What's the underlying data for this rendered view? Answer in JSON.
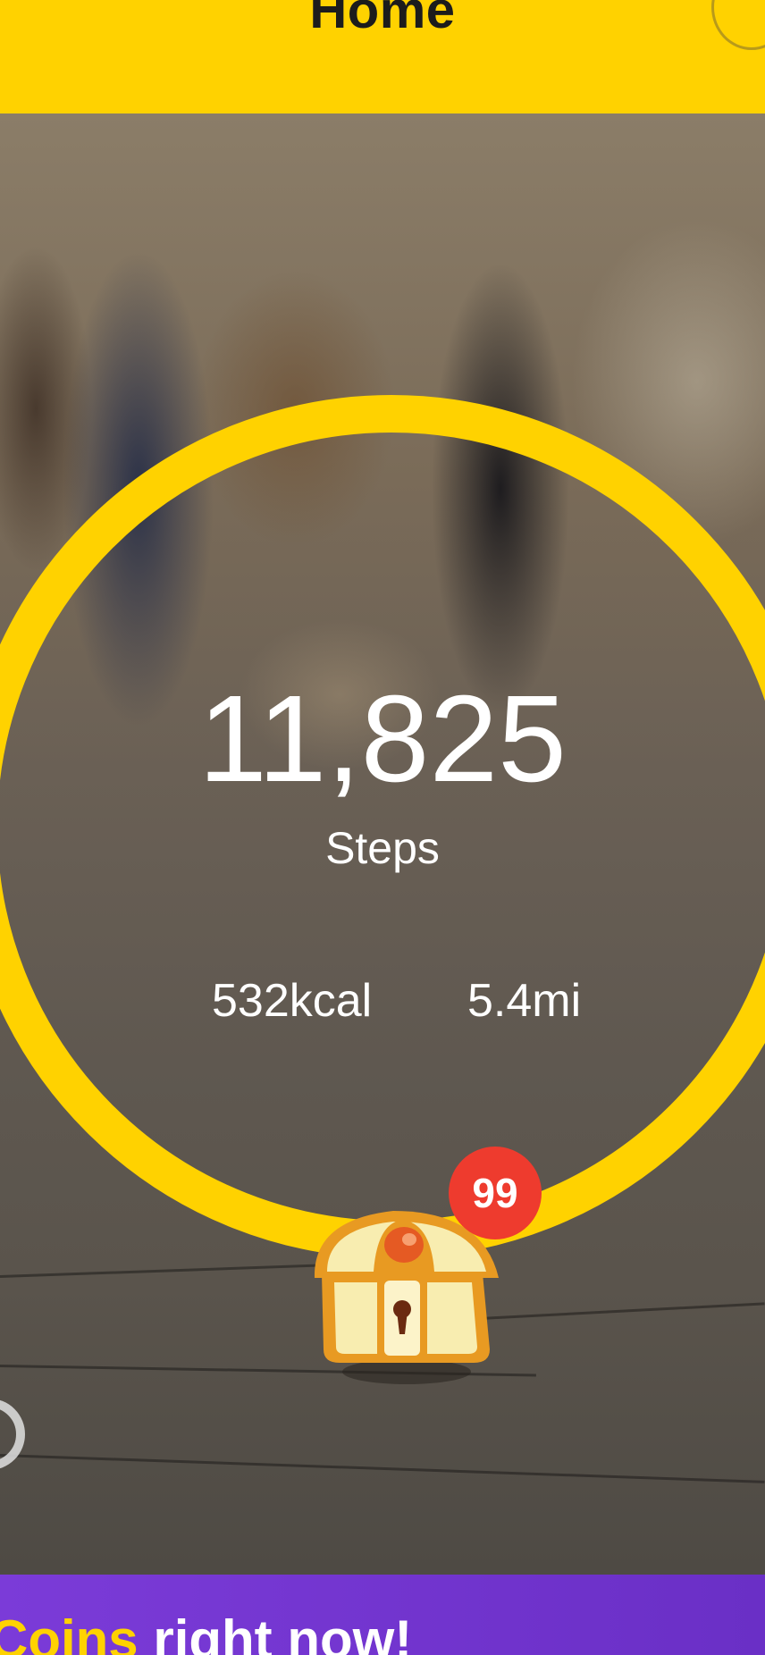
{
  "header": {
    "title": "Home"
  },
  "main": {
    "steps_count": "11,825",
    "steps_label": "Steps",
    "calories": "532kcal",
    "distance": "5.4mi",
    "step_goal_progress": 1.0
  },
  "reward": {
    "chest_icon": "treasure-chest-icon",
    "badge_count": "99"
  },
  "banner": {
    "coins_word": "Coins",
    "rest_text": "right now!"
  },
  "colors": {
    "accent": "#FFD200",
    "badge": "#EE3B2E",
    "banner": "#6F33CC"
  }
}
